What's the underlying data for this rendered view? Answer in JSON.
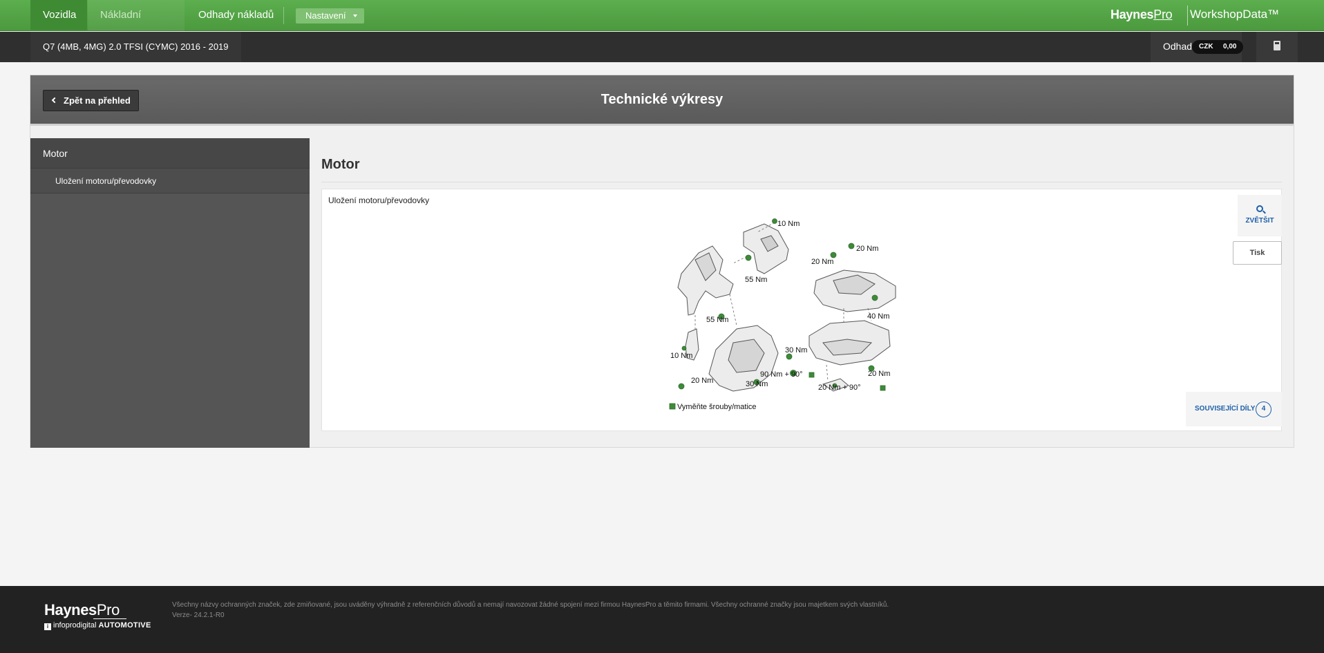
{
  "nav": {
    "tabs": [
      {
        "label": "Vozidla"
      },
      {
        "label": "Nákladní vozidla"
      },
      {
        "label": "Odhady nákladů"
      }
    ],
    "settings_label": "Nastavení",
    "brand": {
      "haynes": "Haynes",
      "pro": "Pro",
      "product": "WorkshopData™"
    }
  },
  "vehicle": {
    "title": "Q7 (4MB, 4MG) 2.0 TFSI (CYMC) 2016 - 2019",
    "estimate_label": "Odhad",
    "currency": "CZK",
    "amount": "0,00"
  },
  "panel": {
    "back_label": "Zpět na přehled",
    "title": "Technické výkresy"
  },
  "sidebar": {
    "heading": "Motor",
    "items": [
      {
        "label": "Uložení motoru/převodovky"
      }
    ]
  },
  "content": {
    "title": "Motor",
    "card_label": "Uložení motoru/převodovky",
    "zoom_label": "ZVĚTŠIT",
    "print_label": "Tisk",
    "related_label": "SOUVISEJÍCÍ DÍLY",
    "related_count": "4"
  },
  "drawing": {
    "torques": {
      "t1": "10 Nm",
      "t2": "55 Nm",
      "t3": "20 Nm",
      "t4": "20 Nm",
      "t5": "40 Nm",
      "t6": "55 Nm",
      "t7": "10 Nm",
      "t8": "30 Nm",
      "t9": "20 Nm",
      "t10": "30 Nm",
      "t11": "90 Nm + 90°",
      "t12": "20 Nm",
      "t13": "20 Nm + 90°"
    },
    "legend": "Vyměňte šrouby/matice",
    "accent_color": "#3e8a3a"
  },
  "footer": {
    "haynes": "Haynes",
    "pro": "Pro",
    "ipd_prefix": "infopro",
    "ipd_mid": "digital",
    "ipd_suffix": "AUTOMOTIVE",
    "disclaimer": "Všechny názvy ochranných značek, zde zmiňované, jsou uváděny výhradně z referenčních důvodů a nemají navozovat žádné spojení mezi firmou HaynesPro a těmito firmami. Všechny ochranné značky jsou majetkem svých vlastníků.",
    "version": "Verze- 24.2.1-R0"
  },
  "icons": [
    "chevron-left-icon",
    "caret-down-icon",
    "calculator-icon",
    "search-icon"
  ]
}
